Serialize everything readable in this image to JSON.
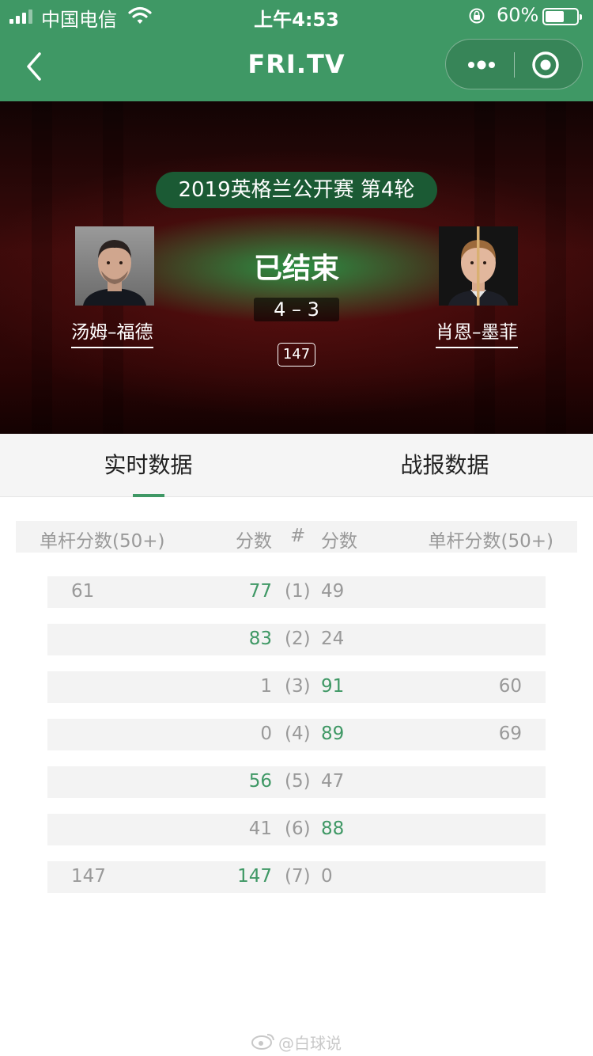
{
  "status_bar": {
    "carrier": "中国电信",
    "time": "上午4:53",
    "battery": "60%",
    "battery_level": 0.6,
    "signal_bars": 4,
    "signal_active": 3
  },
  "nav": {
    "title": "FRI.TV",
    "icons": [
      "chevron-left-icon",
      "more-icon",
      "target-icon"
    ]
  },
  "match": {
    "event": "2019英格兰公开赛 第4轮",
    "status": "已结束",
    "score": "4 – 3",
    "badge": "147",
    "player_left": "汤姆–福德",
    "player_right": "肖恩–墨菲"
  },
  "tabs": [
    {
      "label": "实时数据",
      "active": true
    },
    {
      "label": "战报数据",
      "active": false
    }
  ],
  "table": {
    "headers": {
      "break_left": "单杆分数(50+)",
      "score_left": "分数",
      "frame": "#",
      "score_right": "分数",
      "break_right": "单杆分数(50+)"
    },
    "rows": [
      {
        "break_left": "61",
        "score_left": "77",
        "frame": "(1)",
        "score_right": "49",
        "break_right": "",
        "winner": "left"
      },
      {
        "break_left": "",
        "score_left": "83",
        "frame": "(2)",
        "score_right": "24",
        "break_right": "",
        "winner": "left"
      },
      {
        "break_left": "",
        "score_left": "1",
        "frame": "(3)",
        "score_right": "91",
        "break_right": "60",
        "winner": "right"
      },
      {
        "break_left": "",
        "score_left": "0",
        "frame": "(4)",
        "score_right": "89",
        "break_right": "69",
        "winner": "right"
      },
      {
        "break_left": "",
        "score_left": "56",
        "frame": "(5)",
        "score_right": "47",
        "break_right": "",
        "winner": "left"
      },
      {
        "break_left": "",
        "score_left": "41",
        "frame": "(6)",
        "score_right": "88",
        "break_right": "",
        "winner": "right"
      },
      {
        "break_left": "147",
        "score_left": "147",
        "frame": "(7)",
        "score_right": "0",
        "break_right": "",
        "winner": "left"
      }
    ]
  },
  "watermark": "@白球说",
  "colors": {
    "brand_green": "#3f9865",
    "pill_green": "#1b5a34",
    "muted_text": "#999999"
  }
}
